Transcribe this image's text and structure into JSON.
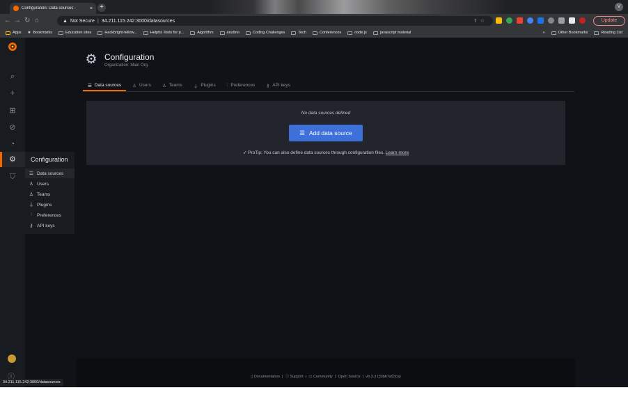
{
  "browser": {
    "tab_title": "Configuration: Data sources - ",
    "tab_close": "×",
    "new_tab": "+",
    "profile": "V",
    "warning_glyph": "▲",
    "security_label": "Not Secure",
    "separator": "|",
    "url": "34.211.115.242:3000/datasources",
    "update_label": "Update",
    "bookmarks": [
      "Apps",
      "Bookmarks",
      "Education sites",
      "Hackbright-fellow...",
      "Helpful Tools for p...",
      "Algorithm",
      "arudino",
      "Coding Challenges",
      "Tech",
      "Conferences",
      "node.js",
      "javascript material"
    ],
    "bookmarks_right": [
      "»",
      "Other Bookmarks",
      "Reading List"
    ],
    "status_url": "34.211.115.242:3000/datasources"
  },
  "header": {
    "title": "Configuration",
    "subtitle": "Organization: Main Org."
  },
  "tabs": [
    {
      "label": "Data sources",
      "icon": "database-icon"
    },
    {
      "label": "Users",
      "icon": "user-icon"
    },
    {
      "label": "Teams",
      "icon": "users-icon"
    },
    {
      "label": "Plugins",
      "icon": "plug-icon"
    },
    {
      "label": "Preferences",
      "icon": "sliders-icon"
    },
    {
      "label": "API keys",
      "icon": "key-icon"
    }
  ],
  "submenu": {
    "title": "Configuration",
    "items": [
      {
        "label": "Data sources",
        "icon": "database-icon"
      },
      {
        "label": "Users",
        "icon": "user-icon"
      },
      {
        "label": "Teams",
        "icon": "users-icon"
      },
      {
        "label": "Plugins",
        "icon": "plug-icon"
      },
      {
        "label": "Preferences",
        "icon": "sliders-icon"
      },
      {
        "label": "API keys",
        "icon": "key-icon"
      }
    ]
  },
  "empty_state": {
    "message": "No data sources defined",
    "button_label": "Add data source",
    "protip": "ProTip: You can also define data sources through configuration files.",
    "learn_more": "Learn more"
  },
  "footer": {
    "documentation": "Documentation",
    "support": "Support",
    "community": "Community",
    "open_source": "Open Source",
    "version": "v8.3.3 (30bb7a93ca)"
  },
  "colors": {
    "accent": "#f46800",
    "primary_button": "#3d71d9",
    "background": "#111217",
    "panel": "#22252b"
  }
}
